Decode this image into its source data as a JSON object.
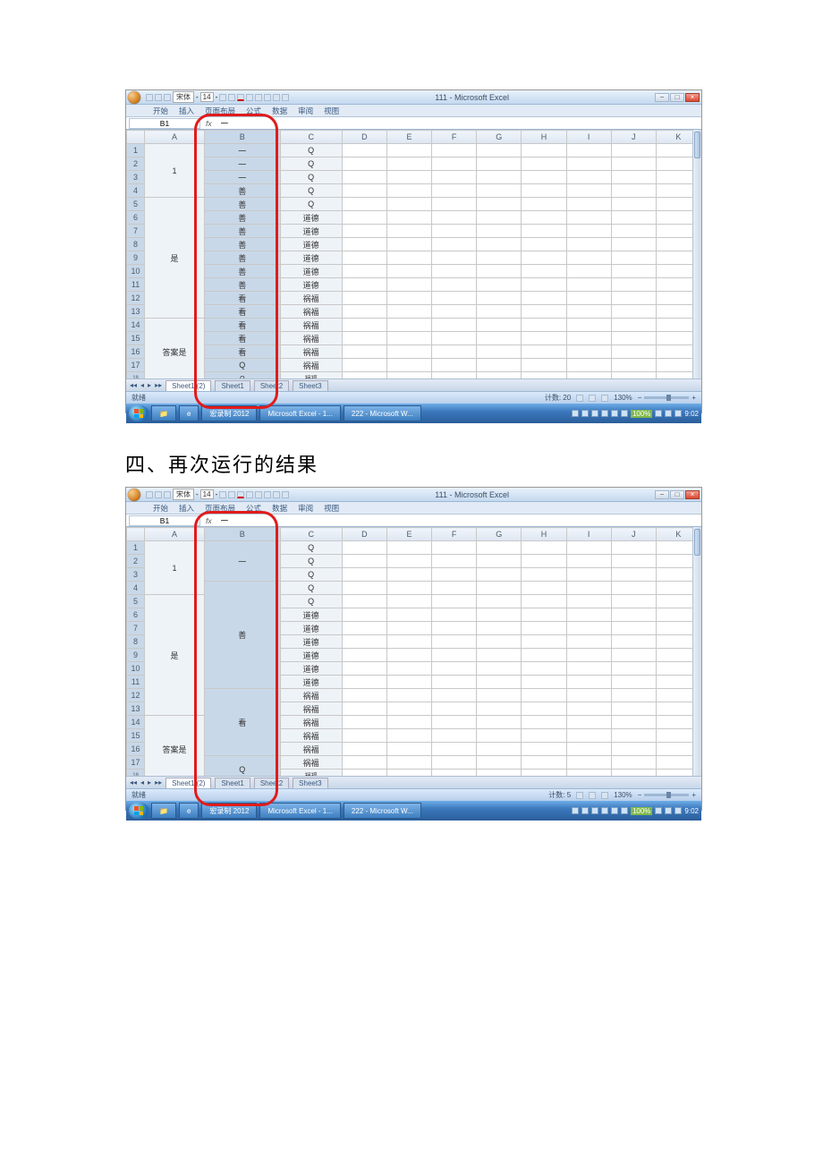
{
  "heading": "四、再次运行的结果",
  "common": {
    "app_title": "111 - Microsoft Excel",
    "tabs": [
      "开始",
      "插入",
      "页面布局",
      "公式",
      "数据",
      "审阅",
      "视图"
    ],
    "font_name": "宋体",
    "font_size": "14",
    "namebox": "B1",
    "fx_value": "一",
    "cols": [
      "",
      "A",
      "B",
      "C",
      "D",
      "E",
      "F",
      "G",
      "H",
      "I",
      "J",
      "K"
    ],
    "sheets": [
      "Sheet1 (2)",
      "Sheet1",
      "Sheet2",
      "Sheet3"
    ],
    "status_label": "就绪",
    "zoom": "130%",
    "task_excel": "Microsoft Excel - 1...",
    "task_word": "222 - Microsoft W...",
    "task_misc": "宏录制 2012",
    "clock": "9:02",
    "batt": "100%"
  },
  "shot1": {
    "count_label": "计数: 20",
    "col_a_merge1": "1",
    "col_a_merge2": "是",
    "col_a_merge3": "答案是",
    "rows": [
      {
        "b": "一",
        "c": "Q"
      },
      {
        "b": "一",
        "c": "Q"
      },
      {
        "b": "一",
        "c": "Q"
      },
      {
        "b": "善",
        "c": "Q"
      },
      {
        "b": "善",
        "c": "Q"
      },
      {
        "b": "善",
        "c": "道德"
      },
      {
        "b": "善",
        "c": "道德"
      },
      {
        "b": "善",
        "c": "道德"
      },
      {
        "b": "善",
        "c": "道德"
      },
      {
        "b": "善",
        "c": "道德"
      },
      {
        "b": "善",
        "c": "道德"
      },
      {
        "b": "看",
        "c": "祸福"
      },
      {
        "b": "看",
        "c": "祸福"
      },
      {
        "b": "看",
        "c": "祸福"
      },
      {
        "b": "看",
        "c": "祸福"
      },
      {
        "b": "看",
        "c": "祸福"
      },
      {
        "b": "Q",
        "c": "祸福"
      },
      {
        "b": "Q",
        "c": "祸福"
      }
    ]
  },
  "shot2": {
    "count_label": "计数: 5",
    "col_a_merge1": "1",
    "col_a_merge2": "是",
    "col_a_merge3": "答案是",
    "b_merge1": "一",
    "b_merge2": "善",
    "b_merge3": "看",
    "b_merge4": "Q",
    "col_c": [
      "Q",
      "Q",
      "Q",
      "Q",
      "Q",
      "道德",
      "道德",
      "道德",
      "道德",
      "道德",
      "道德",
      "祸福",
      "祸福",
      "祸福",
      "祸福",
      "祸福",
      "祸福",
      "祸福"
    ]
  }
}
